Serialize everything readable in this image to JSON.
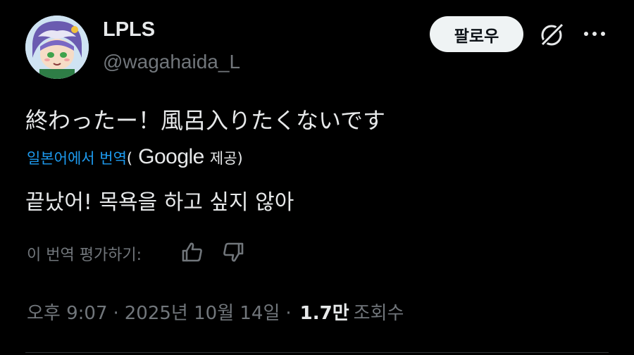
{
  "user": {
    "display_name": "LPLS",
    "handle": "@wagahaida_L",
    "avatar_icon": "anime-avatar"
  },
  "actions": {
    "follow_label": "팔로우",
    "grok_icon": "grok-icon",
    "more_icon": "more-icon"
  },
  "tweet": {
    "text": "終わったー！風呂入りたくないです",
    "translate_link": "일본어에서 번역",
    "translate_paren_open": "(",
    "provider": "Google",
    "provider_suffix": "제공)",
    "translated_text": "끝났어! 목욕을 하고 싶지 않아",
    "rate_label": "이 번역 평가하기:",
    "time": "오후 9:07",
    "separator": "·",
    "date": "2025년 10월 14일",
    "views_count": "1.7만",
    "views_label": "조회수"
  },
  "colors": {
    "background": "#000000",
    "text": "#e7e9ea",
    "secondary": "#71767b",
    "link": "#1d9bf0",
    "button_bg": "#eff3f4"
  }
}
